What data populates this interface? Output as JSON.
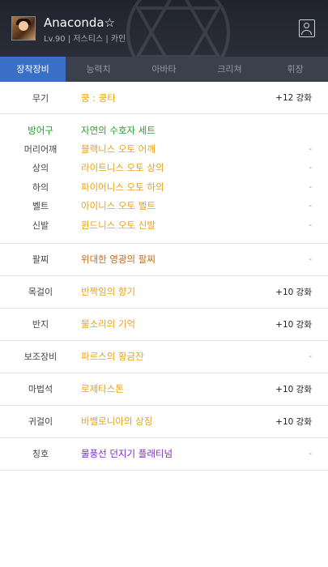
{
  "header": {
    "name": "Anaconda☆",
    "info": "Lv.90 | 저스티스 | 카인"
  },
  "tabs": [
    "장착장비",
    "능력치",
    "아바타",
    "크리쳐",
    "휘장"
  ],
  "weapon": {
    "slot": "무기",
    "item": "쿵 : 쿵타",
    "value": "+12 강화"
  },
  "armor": {
    "slot": "방어구",
    "set_name": "자연의 수호자 세트",
    "pieces": [
      {
        "slot": "머리어깨",
        "item": "블랙니스 오토 어깨",
        "value": "-"
      },
      {
        "slot": "상의",
        "item": "라이트니스 오토 상의",
        "value": "-"
      },
      {
        "slot": "하의",
        "item": "파이어니스 오토 하의",
        "value": "-"
      },
      {
        "slot": "벨트",
        "item": "아이니스 오토 벨트",
        "value": "-"
      },
      {
        "slot": "신발",
        "item": "윈드니스 오토 신발",
        "value": "-"
      }
    ]
  },
  "accessories": [
    {
      "slot": "팔찌",
      "item": "위대한 영광의 팔찌",
      "value": "-"
    },
    {
      "slot": "목걸이",
      "item": "반짝임의 향기",
      "value": "+10 강화"
    },
    {
      "slot": "반지",
      "item": "물소리의 기억",
      "value": "+10 강화"
    },
    {
      "slot": "보조장비",
      "item": "파르스의 황금잔",
      "value": "-"
    },
    {
      "slot": "마법석",
      "item": "로제타스톤",
      "value": "+10 강화"
    },
    {
      "slot": "귀걸이",
      "item": "바벨로니아의 상징",
      "value": "+10 강화"
    },
    {
      "slot": "칭호",
      "item": "물풍선 던지기 플래티넘",
      "value": "-"
    }
  ],
  "colors": {
    "accent_tab": "#3a6fc8",
    "item_gold": "#e8a317",
    "set_green": "#2e9b2e",
    "item_brown": "#c06a1a",
    "title_purple": "#7a28c8"
  }
}
